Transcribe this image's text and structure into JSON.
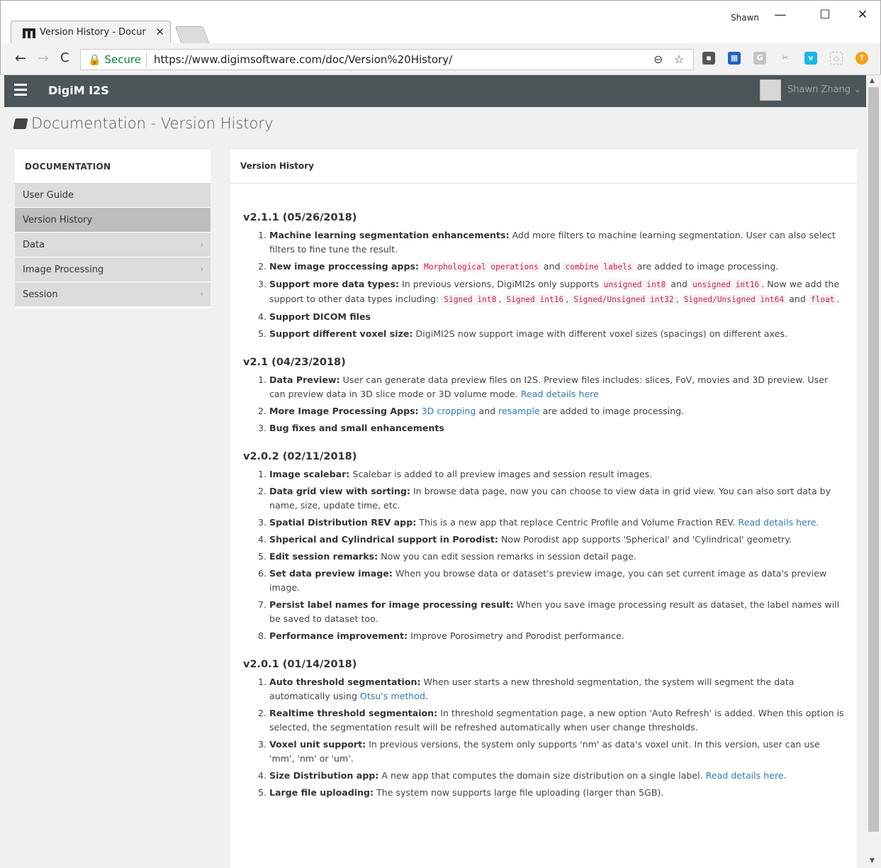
{
  "browser": {
    "tab_title": "Version History - Docume",
    "user_label": "Shawn",
    "secure_label": "Secure",
    "url": "https://www.digimsoftware.com/doc/Version%20History/"
  },
  "app": {
    "brand": "DigiM I2S",
    "username": "Shawn Zhang"
  },
  "page": {
    "title": "Documentation - Version History"
  },
  "sidebar": {
    "heading": "DOCUMENTATION",
    "items": [
      {
        "label": "User Guide"
      },
      {
        "label": "Version History"
      },
      {
        "label": "Data"
      },
      {
        "label": "Image Processing"
      },
      {
        "label": "Session"
      }
    ]
  },
  "content": {
    "heading": "Version History",
    "versions": [
      {
        "title": "v2.1.1 (05/26/2018)",
        "items": [
          {
            "bold": "Machine learning segmentation enhancements:",
            "text": "Add more filters to machine learning segmentation. User can also select filters to fine tune the result."
          },
          {
            "bold": "New image proccessing apps:",
            "code1": "Morphological operations",
            "and": "and",
            "code2": "combine labels",
            "text": "are added to image processing."
          },
          {
            "bold": "Support more data types:",
            "text1": "In previous versions, DigiMI2s only supports",
            "code1": "unsigned int8",
            "and1": "and",
            "code2": "unsigned int16",
            "text2": ". Now we add the support to other data types including:",
            "code3": "Signed int8",
            "code4": "Signed int16",
            "code5": "Signed/Unsigned int32",
            "code6": "Signed/Unsigned int64",
            "and2": "and",
            "code7": "float",
            "end": "."
          },
          {
            "bold": "Support DICOM files"
          },
          {
            "bold": "Support different voxel size:",
            "text": "DigiMI2S now support image with different voxel sizes (spacings) on different axes."
          }
        ]
      },
      {
        "title": "v2.1 (04/23/2018)",
        "items": [
          {
            "bold": "Data Preview:",
            "text": "User can generate data preview files on I2S. Preview files includes: slices, FoV, movies and 3D preview. User can preview data in 3D slice mode or 3D volume mode.",
            "link": "Read details here"
          },
          {
            "bold": "More Image Processing Apps:",
            "link1": "3D cropping",
            "and": "and",
            "link2": "resample",
            "text": "are added to image processing."
          },
          {
            "bold": "Bug fixes and small enhancements"
          }
        ]
      },
      {
        "title": "v2.0.2 (02/11/2018)",
        "items": [
          {
            "bold": "Image scalebar:",
            "text": "Scalebar is added to all preview images and session result images."
          },
          {
            "bold": "Data grid view with sorting:",
            "text": "In browse data page, now you can choose to view data in grid view. You can also sort data by name, size, update time, etc."
          },
          {
            "bold": "Spatial Distribution REV app:",
            "text": "This is a new app that replace Centric Profile and Volume Fraction REV.",
            "link": "Read details here."
          },
          {
            "bold": "Shperical and Cylindrical support in Porodist:",
            "text": "Now Porodist app supports 'Spherical' and 'Cylindrical' geometry."
          },
          {
            "bold": "Edit session remarks:",
            "text": "Now you can edit session remarks in session detail page."
          },
          {
            "bold": "Set data preview image:",
            "text": "When you browse data or dataset's preview image, you can set current image as data's preview image."
          },
          {
            "bold": "Persist label names for image processing result:",
            "text": "When you save image processing result as dataset, the label names will be saved to dataset too."
          },
          {
            "bold": "Performance improvement:",
            "text": "Improve Porosimetry and Porodist performance."
          }
        ]
      },
      {
        "title": "v2.0.1 (01/14/2018)",
        "items": [
          {
            "bold": "Auto threshold segmentation:",
            "text": "When user starts a new threshold segmentation, the system will segment the data automatically using",
            "link": "Otsu's method",
            "end": "."
          },
          {
            "bold": "Realtime threshold segmentaion:",
            "text": "In threshold segmentation page, a new option 'Auto Refresh' is added. When this option is selected, the segmentation result will be refreshed automatically when user change thresholds."
          },
          {
            "bold": "Voxel unit support:",
            "text": "In previous versions, the system only supports 'nm' as data's voxel unit. In this version, user can use 'mm', 'nm' or 'um'."
          },
          {
            "bold": "Size Distribution app:",
            "text": "A new app that computes the domain size distribution on a single label.",
            "link": "Read details here."
          },
          {
            "bold": "Large file uploading:",
            "text": "The system now supports large file uploading (larger than 5GB)."
          }
        ]
      }
    ]
  }
}
